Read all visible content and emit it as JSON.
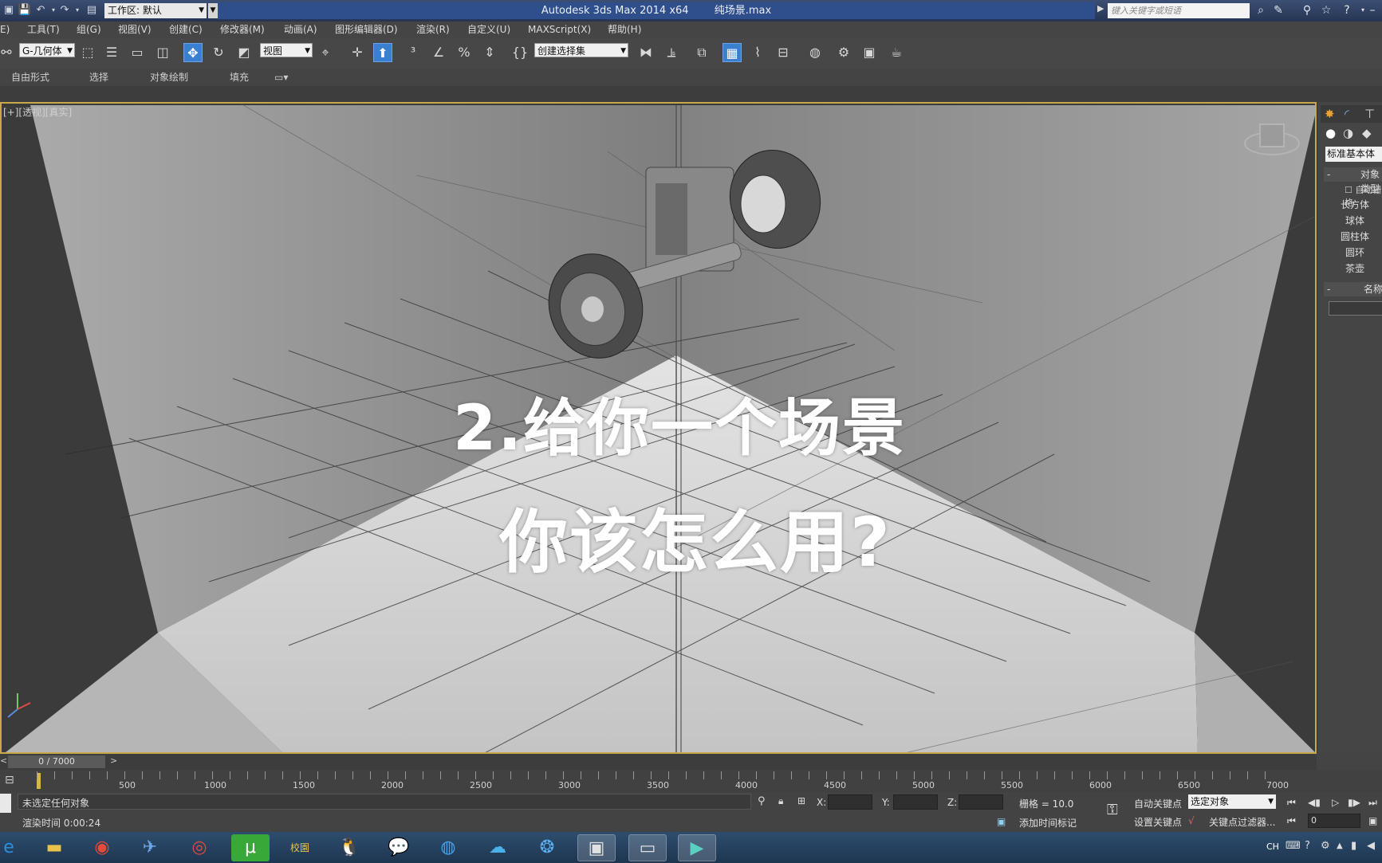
{
  "titlebar": {
    "workspace_label": "工作区: 默认",
    "app_name": "Autodesk 3ds Max  2014 x64",
    "file_name": "纯场景.max",
    "search_placeholder": "键入关键字或短语"
  },
  "menu": [
    "E)",
    "工具(T)",
    "组(G)",
    "视图(V)",
    "创建(C)",
    "修改器(M)",
    "动画(A)",
    "图形编辑器(D)",
    "渲染(R)",
    "自定义(U)",
    "MAXScript(X)",
    "帮助(H)"
  ],
  "toolbar": {
    "layer_select": "G-几何体",
    "ref_coord": "视图",
    "named_selection": "创建选择集"
  },
  "ribbon_tabs": [
    "自由形式",
    "选择",
    "对象绘制",
    "填充"
  ],
  "viewport": {
    "label": "[+][透视][真实]",
    "overlay_line1": "2.给你一个场景",
    "overlay_line2": "你该怎么用?"
  },
  "command_panel": {
    "category": "标准基本体",
    "rollout_object_type": "对象类型",
    "autogrid": "自动栅格",
    "objects": [
      "长方体",
      "球体",
      "圆柱体",
      "圆环",
      "茶壶"
    ],
    "rollout_name": "名称"
  },
  "timeline": {
    "slider_text": "0 / 7000",
    "ticks": [
      "500",
      "1000",
      "1500",
      "2000",
      "2500",
      "3000",
      "3500",
      "4000",
      "4500",
      "5000",
      "5500",
      "6000",
      "6500",
      "7000"
    ]
  },
  "status": {
    "selection": "未选定任何对象",
    "render_time": "渲染时间  0:00:24",
    "x_label": "X:",
    "y_label": "Y:",
    "z_label": "Z:",
    "grid": "栅格 = 10.0",
    "add_time_tag": "添加时间标记",
    "auto_key": "自动关键点",
    "set_key": "设置关键点",
    "key_mode": "选定对象",
    "key_filters": "关键点过滤器...",
    "frame": "0"
  },
  "taskbar": {
    "tray_lang": "CH"
  }
}
